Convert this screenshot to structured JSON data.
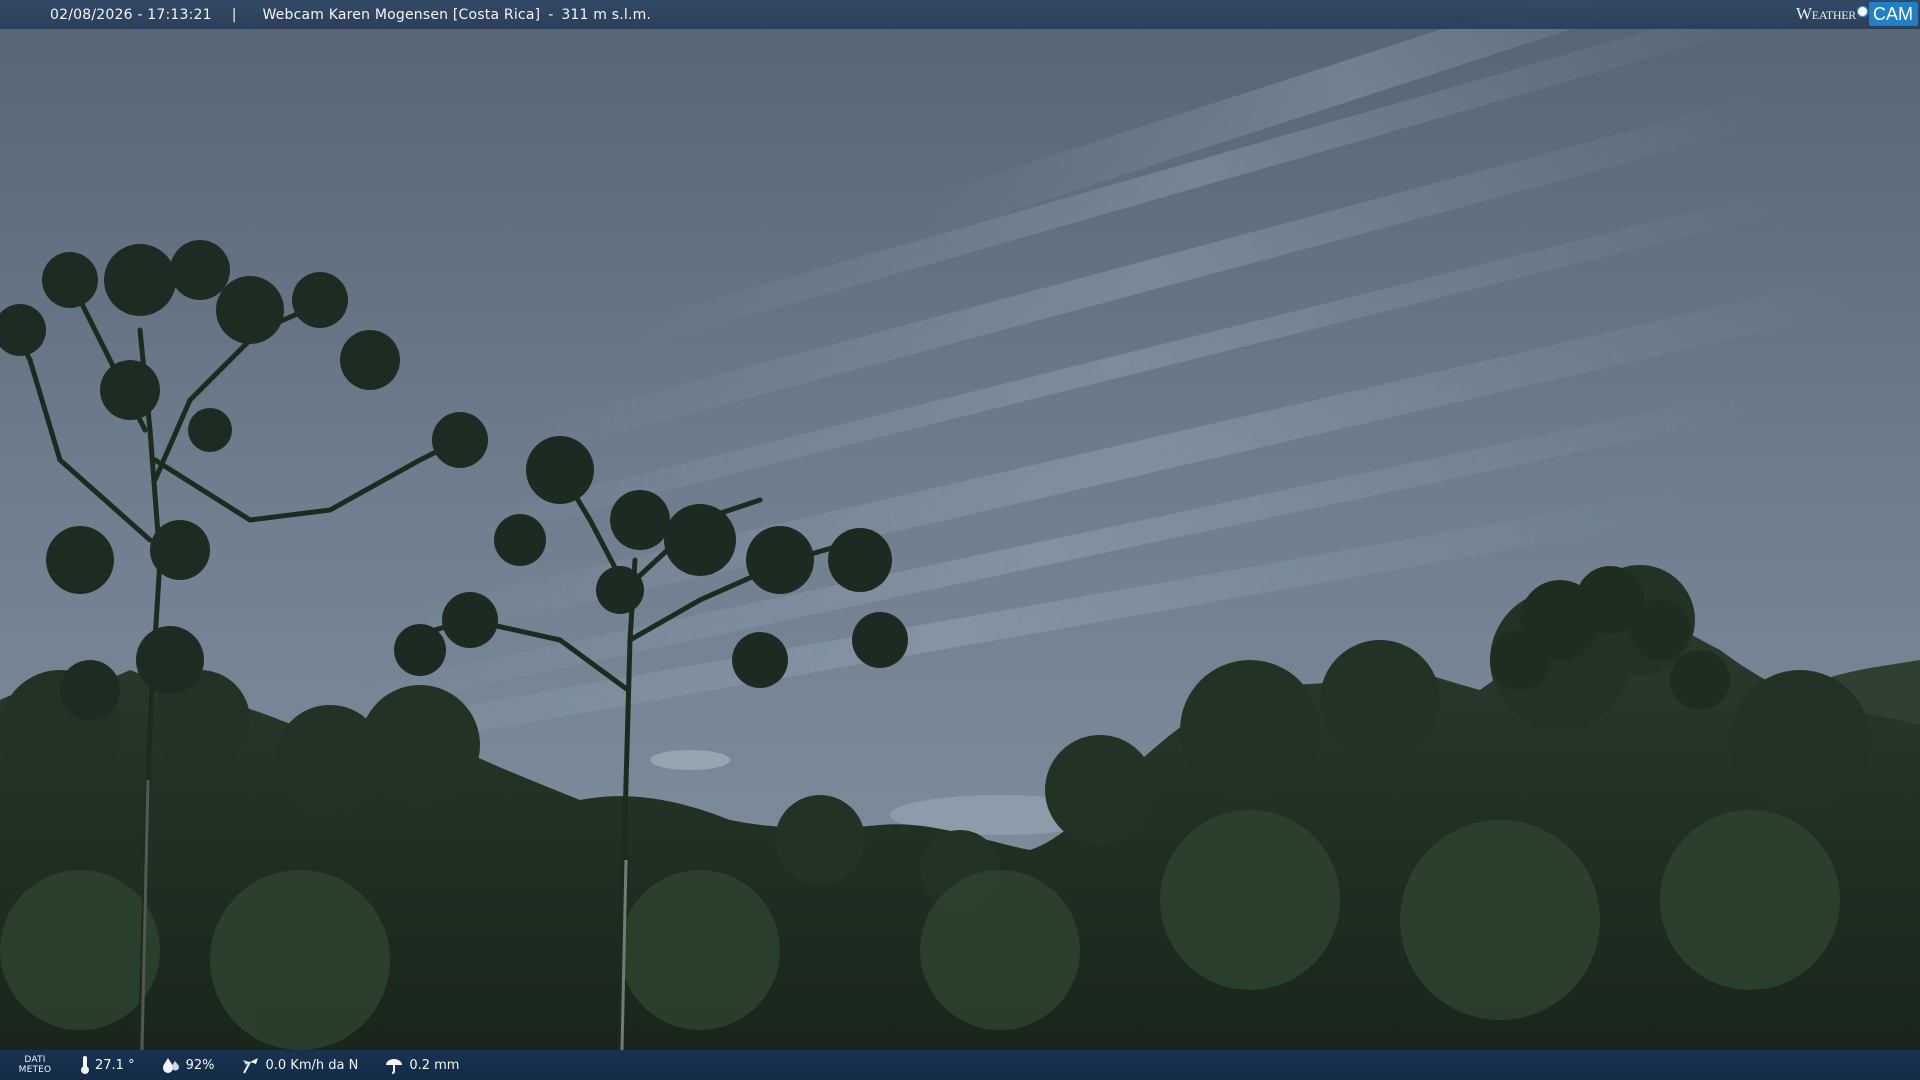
{
  "header": {
    "timestamp": "02/08/2026 - 17:13:21",
    "separator": "|",
    "webcam_name": "Webcam Karen Mogensen [Costa Rica]",
    "dash": "-",
    "altitude": "311 m s.l.m."
  },
  "logo": {
    "weather_text": "Weather",
    "cam_text": "CAM"
  },
  "weather_bar": {
    "label_line1": "DATI",
    "label_line2": "METEO",
    "temperature": "27.1 °",
    "humidity": "92%",
    "wind": "0.0 Km/h da N",
    "rain": "0.2 mm",
    "icons": [
      "thermometer-icon",
      "humidity-icon",
      "wind-icon",
      "rain-icon"
    ]
  },
  "colors": {
    "sky_top": "#5a6877",
    "sky_bottom": "#7a8a99",
    "foliage_dark": "#1c2a1e",
    "foliage_mid": "#2b3d2b",
    "bar_bg": "#1f3c5c",
    "logo_accent": "#1f7fc8"
  }
}
